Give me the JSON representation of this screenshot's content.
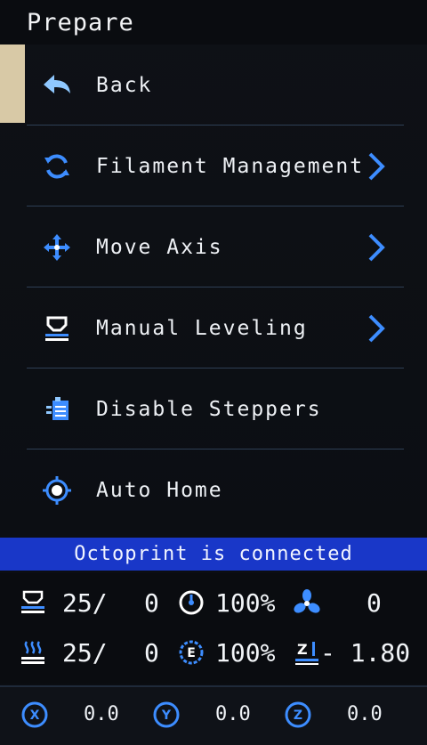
{
  "title": "Prepare",
  "menu": [
    {
      "label": "Back",
      "icon": "back-arrow-icon",
      "chevron": false
    },
    {
      "label": "Filament Management",
      "icon": "refresh-icon",
      "chevron": true
    },
    {
      "label": "Move Axis",
      "icon": "move-axis-icon",
      "chevron": true
    },
    {
      "label": "Manual Leveling",
      "icon": "bed-leveling-icon",
      "chevron": true
    },
    {
      "label": "Disable Steppers",
      "icon": "stepper-icon",
      "chevron": false
    },
    {
      "label": "Auto Home",
      "icon": "crosshair-home-icon",
      "chevron": false
    }
  ],
  "status": "Octoprint is connected",
  "stats": {
    "bed_current": "25/",
    "bed_target": "0",
    "speed": "100%",
    "fan": "0",
    "hotend_current": "25/",
    "hotend_target": "0",
    "flow": "100%",
    "z_offset": "- 1.80"
  },
  "axes": {
    "x_value": "0.0",
    "y_value": "0.0",
    "z_value": "0.0"
  },
  "colors": {
    "accent_blue": "#2f8cff",
    "status_bar": "#1937c8",
    "selector": "#d8c9a6"
  }
}
